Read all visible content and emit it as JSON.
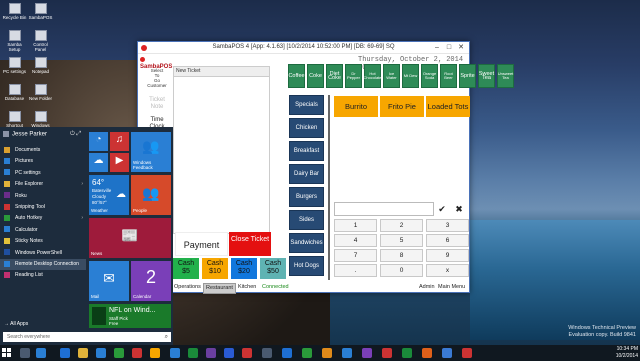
{
  "desktop": {
    "icons": [
      {
        "label": "Recycle Bin"
      },
      {
        "label": "SambaPOS"
      },
      {
        "label": "Samba Setup"
      },
      {
        "label": "Control Panel"
      },
      {
        "label": "PC settings"
      },
      {
        "label": "Notepad"
      },
      {
        "label": "Database"
      },
      {
        "label": "New Folder"
      },
      {
        "label": "Shortcut"
      },
      {
        "label": "Windows Live"
      }
    ]
  },
  "sambapos": {
    "window_title": "SambaPOS 4 [App: 4.1.63] [10/2/2014 10:52:00 PM] [DB: 69-69] SQ",
    "logo_text": "SambaPOS",
    "side_items": [
      "Select",
      "To",
      "Go",
      "Customer"
    ],
    "side_big": [
      "Ticket",
      "Note",
      "Time",
      "Clock"
    ],
    "ticket_header": "New Ticket",
    "date_text": "Thursday, October 2, 2014 10:30 PM",
    "drinks": [
      "Coffee",
      "Coke",
      "Diet Coke",
      "Dr Pepper",
      "Hot Chocolate",
      "Ice Water",
      "Mt Dew",
      "Orange Soda",
      "Root Beer",
      "Sprite",
      "Sweet Tea",
      "Unsweet Tea"
    ],
    "categories": [
      "Specials",
      "Chicken",
      "Breakfast",
      "Dairy Bar",
      "Burgers",
      "Sides",
      "Sandwiches",
      "Hot Dogs"
    ],
    "menu_items": [
      "Burrito",
      "Frito Pie",
      "Loaded Tots"
    ],
    "keypad_ok": "✔",
    "keypad_clear": "✖",
    "numpad_keys": [
      "1",
      "2",
      "3",
      "4",
      "5",
      "6",
      "7",
      "8",
      "9",
      ".",
      "0",
      "x"
    ],
    "payment_label": "Payment",
    "close_ticket_label": "Close Ticket",
    "cash_buttons": [
      {
        "line1": "Cash",
        "line2": "$5",
        "color": "#22b14c"
      },
      {
        "line1": "Cash",
        "line2": "$10",
        "color": "#f7a600"
      },
      {
        "line1": "Cash",
        "line2": "$20",
        "color": "#1177dd"
      },
      {
        "line1": "Cash",
        "line2": "$50",
        "color": "#5fb3b3"
      }
    ],
    "bottom_tabs": [
      "Operations",
      "Restaurant",
      "Kitchen",
      "Connected",
      "Admin",
      "Main Menu"
    ]
  },
  "start_menu": {
    "user_name": "Jesse Parker",
    "apps": [
      {
        "label": "Documents",
        "color": "#d9a030",
        "arrow": false
      },
      {
        "label": "Pictures",
        "color": "#2a7fd4",
        "arrow": false
      },
      {
        "label": "PC settings",
        "color": "#2a7fd4",
        "arrow": false
      },
      {
        "label": "File Explorer",
        "color": "#e1b33a",
        "arrow": true
      },
      {
        "label": "Roku",
        "color": "#6b2d8a",
        "arrow": false
      },
      {
        "label": "Snipping Tool",
        "color": "#cc3333",
        "arrow": false
      },
      {
        "label": "Auto Hotkey",
        "color": "#2a9a3a",
        "arrow": true
      },
      {
        "label": "Calculator",
        "color": "#2a7fd4",
        "arrow": false
      },
      {
        "label": "Sticky Notes",
        "color": "#e1c13a",
        "arrow": false
      },
      {
        "label": "Windows PowerShell",
        "color": "#1f4fa0",
        "arrow": false
      },
      {
        "label": "Remote Desktop Connection",
        "color": "#2a7fd4",
        "arrow": false
      },
      {
        "label": "Reading List",
        "color": "#c03070",
        "arrow": false
      }
    ],
    "all_apps": "All Apps",
    "search_placeholder": "Search everywhere",
    "tiles": {
      "windows_feedback": "Windows Feedback",
      "weather_temp": "64°",
      "weather_city": "Batesville",
      "weather_cond": "Cloudy",
      "weather_hilo": "80°/57°",
      "weather_label": "Weather",
      "people": "People",
      "news": "News",
      "mail": "Mail",
      "calendar_day": "2",
      "calendar_label": "Calendar",
      "nfl_title": "NFL on Wind...",
      "nfl_sub1": "Staff Pick",
      "nfl_sub2": "Free"
    }
  },
  "taskbar": {
    "time": "10:34 PM",
    "date": "10/2/2014"
  },
  "watermark": {
    "line1": "Windows Technical Preview",
    "line2": "Evaluation copy. Build 9841"
  }
}
